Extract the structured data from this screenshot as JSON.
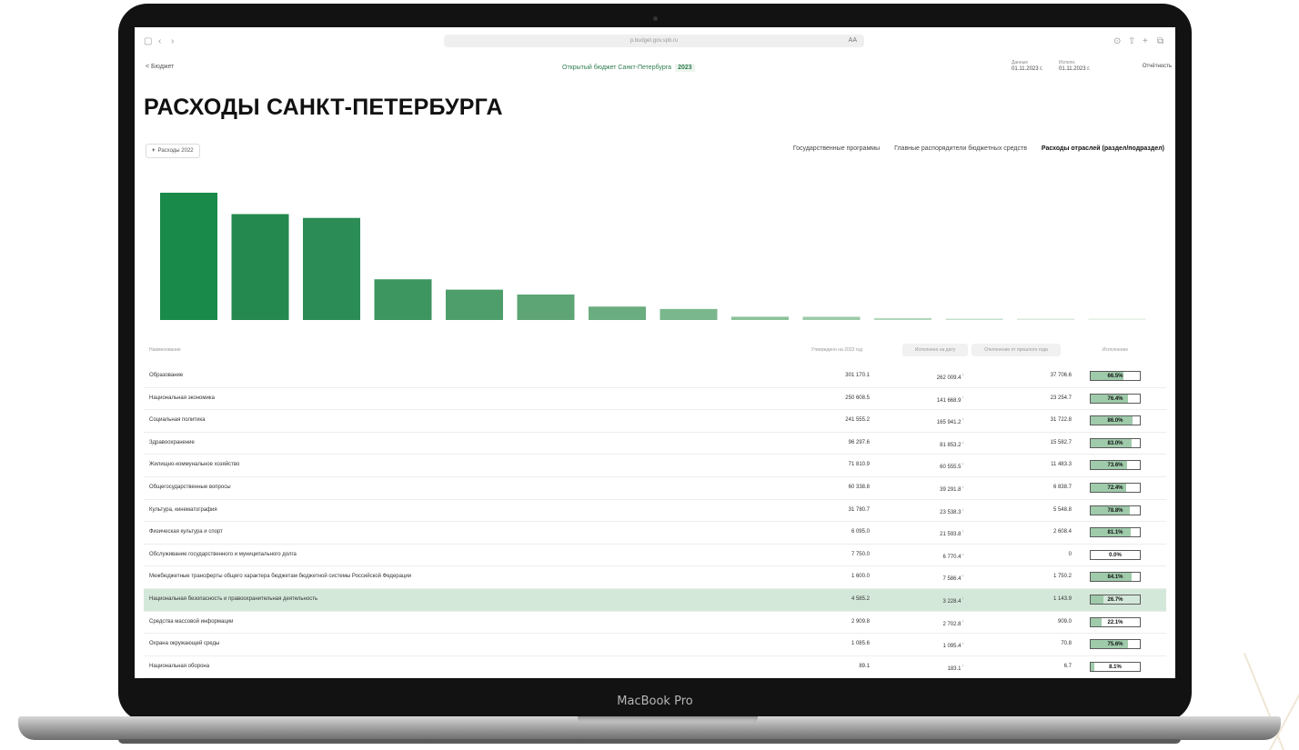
{
  "device": {
    "brand": "MacBook Pro"
  },
  "browser": {
    "url": "p.budget.gov.spb.ru",
    "reader_label": "AA",
    "left_icons": [
      "sidebar-icon",
      "back-icon",
      "forward-icon"
    ],
    "right_icons": [
      "history-icon",
      "share-icon",
      "new-tab-icon",
      "tabs-icon"
    ]
  },
  "header": {
    "back_label": "< Бюджет",
    "center_title": "Открытый бюджет Санкт-Петербурга",
    "year": "2023",
    "meta": [
      {
        "label": "Данные",
        "value": "01.11.2023 г."
      },
      {
        "label": "Исполн.",
        "value": "01.11.2023 г."
      }
    ],
    "right_link": "Отчётность"
  },
  "page_title": "РАСХОДЫ САНКТ-ПЕТЕРБУРГА",
  "prev_year_button": {
    "icon": "+",
    "label": "Расходы 2022"
  },
  "tabs": [
    {
      "label": "Государственные программы",
      "active": false
    },
    {
      "label": "Главные распорядители бюджетных средств",
      "active": false
    },
    {
      "label": "Расходы отраслей (раздел/подраздел)",
      "active": true
    }
  ],
  "table": {
    "headers": [
      "Наименование",
      "Утверждено на 2023 год",
      "Исполнено на дату",
      "Отклонение от прошлого года",
      "Исполнение"
    ],
    "rows": [
      {
        "name": "Образование",
        "v1": "301 170.1",
        "v2": "262 009.4",
        "trend": "up",
        "v3": "37 706.6",
        "pct": "66.5%",
        "fill": 0.665,
        "highlighted": false
      },
      {
        "name": "Национальная экономика",
        "v1": "250 608.5",
        "v2": "141 668.9",
        "trend": "up",
        "v3": "23 254.7",
        "pct": "76.4%",
        "fill": 0.764,
        "highlighted": false
      },
      {
        "name": "Социальная политика",
        "v1": "241 555.2",
        "v2": "165 941.2",
        "trend": "up",
        "v3": "31 722.8",
        "pct": "86.0%",
        "fill": 0.86,
        "highlighted": false
      },
      {
        "name": "Здравоохранение",
        "v1": "96 297.6",
        "v2": "81 853.2",
        "trend": "down",
        "v3": "15 582.7",
        "pct": "83.0%",
        "fill": 0.83,
        "highlighted": false
      },
      {
        "name": "Жилищно-коммунальное хозяйство",
        "v1": "71 810.9",
        "v2": "60 555.5",
        "trend": "up",
        "v3": "11 483.3",
        "pct": "73.6%",
        "fill": 0.736,
        "highlighted": false
      },
      {
        "name": "Общегосударственные вопросы",
        "v1": "60 338.8",
        "v2": "39 291.8",
        "trend": "down",
        "v3": "6 838.7",
        "pct": "72.4%",
        "fill": 0.724,
        "highlighted": false
      },
      {
        "name": "Культура, кинематография",
        "v1": "31 780.7",
        "v2": "23 538.3",
        "trend": "down",
        "v3": "5 548.8",
        "pct": "78.8%",
        "fill": 0.788,
        "highlighted": false
      },
      {
        "name": "Физическая культура и спорт",
        "v1": "6 095.0",
        "v2": "21 593.8",
        "trend": "up",
        "v3": "2 608.4",
        "pct": "81.1%",
        "fill": 0.811,
        "highlighted": false
      },
      {
        "name": "Обслуживание государственного и муниципального долга",
        "v1": "7 750.0",
        "v2": "6 770.4",
        "trend": "down",
        "v3": "0",
        "pct": "0.0%",
        "fill": 0,
        "highlighted": false
      },
      {
        "name": "Межбюджетные трансферты общего характера бюджетам бюджетной системы Российской Федерации",
        "v1": "1 600.0",
        "v2": "7 586.4",
        "trend": "up",
        "v3": "1 750.2",
        "pct": "84.1%",
        "fill": 0.841,
        "highlighted": false
      },
      {
        "name": "Национальная безопасность и правоохранительная деятельность",
        "v1": "4 585.2",
        "v2": "3 228.4",
        "trend": "up",
        "v3": "1 143.9",
        "pct": "26.7%",
        "fill": 0.267,
        "highlighted": true
      },
      {
        "name": "Средства массовой информации",
        "v1": "2 909.8",
        "v2": "2 702.8",
        "trend": "up",
        "v3": "909.0",
        "pct": "22.1%",
        "fill": 0.221,
        "highlighted": false
      },
      {
        "name": "Охрана окружающей среды",
        "v1": "1 085.6",
        "v2": "1 095.4",
        "trend": "down",
        "v3": "70.8",
        "pct": "75.6%",
        "fill": 0.756,
        "highlighted": false
      },
      {
        "name": "Национальная оборона",
        "v1": "89.1",
        "v2": "183.1",
        "trend": "up",
        "v3": "6.7",
        "pct": "8.1%",
        "fill": 0.081,
        "highlighted": false
      }
    ]
  },
  "chart_data": {
    "type": "bar",
    "categories": [
      "Образование",
      "Национальная экономика",
      "Социальная политика",
      "Здравоохранение",
      "Жилищно-коммунальное хозяйство",
      "Общегосударственные вопросы",
      "Культура, кинематография",
      "Физическая культура и спорт",
      "Обслуживание государственного и муниципального долга",
      "Межбюджетные трансферты общего характера бюджетам бюджетной системы Российской Федерации",
      "Национальная безопасность и правоохранительная деятельность",
      "Средства массовой информации",
      "Охрана окружающей среды",
      "Национальная оборона"
    ],
    "values": [
      301170.1,
      250608.5,
      241555.2,
      96297.6,
      71810.9,
      60338.8,
      31780.7,
      26095.0,
      7750.0,
      7600.0,
      4585.2,
      2909.8,
      1085.6,
      89.1
    ],
    "colors": [
      "#1a8a4a",
      "#23894e",
      "#2c8c55",
      "#3d955f",
      "#4e9e6b",
      "#5ea576",
      "#6aad80",
      "#7ab78c",
      "#8cc29a",
      "#9ccaa8",
      "#b2d7bb",
      "#c5e0cc",
      "#d8e9dc",
      "#e4efe6"
    ],
    "title": "",
    "xlabel": "",
    "ylabel": "",
    "grid": false,
    "legend": "none"
  }
}
